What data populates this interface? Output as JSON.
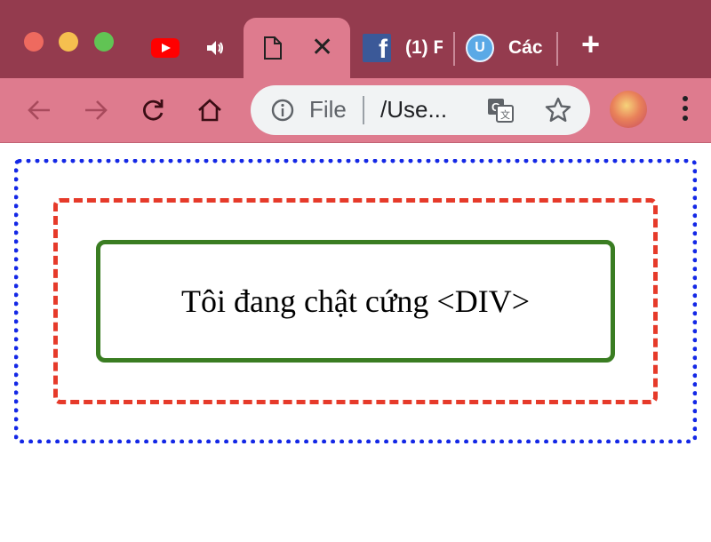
{
  "browser": {
    "tabs": [
      {
        "icon": "youtube-icon",
        "title": ""
      },
      {
        "icon": "speaker-icon",
        "title": ""
      },
      {
        "icon": "document-icon",
        "title": "",
        "active": true
      },
      {
        "icon": "facebook-icon",
        "title": "(1) F"
      },
      {
        "icon": "site-icon",
        "title": "Các"
      }
    ],
    "omnibox": {
      "scheme_label": "File",
      "url": "/Use..."
    }
  },
  "page": {
    "inner_text": "Tôi đang chật cứng <DIV>"
  },
  "colors": {
    "tabbar_bg": "#943b4e",
    "toolbar_bg": "#de7b8e",
    "outer_border": "#1428e6",
    "middle_border": "#e63a2a",
    "inner_border": "#3a7d22"
  }
}
